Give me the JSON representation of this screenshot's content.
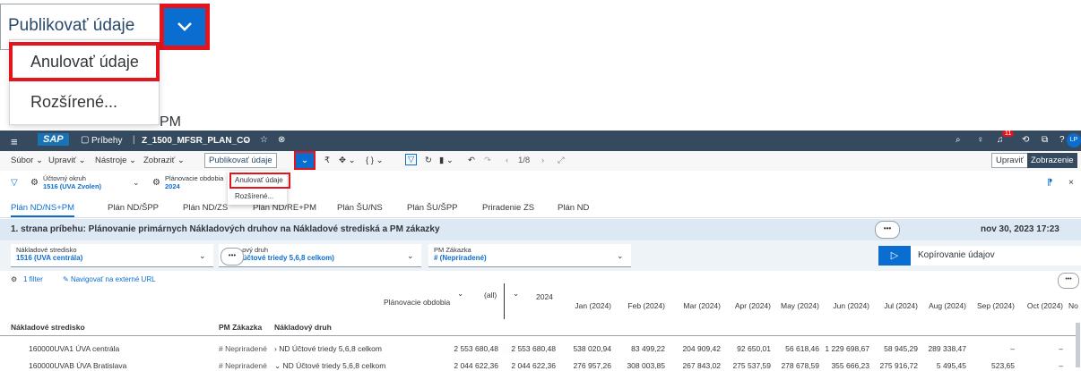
{
  "zoom": {
    "publish_label": "Publikovať údaje",
    "menu_items": [
      "Anulovať údaje",
      "Rozšírené..."
    ],
    "cutoff_text": "PM"
  },
  "shell": {
    "logo": "SAP",
    "stories_label": "Príbehy",
    "story_title": "Z_1500_MFSR_PLAN_CO",
    "notification_count": "11",
    "avatar": "LP"
  },
  "toolbar": {
    "menus": [
      "Súbor",
      "Upraviť",
      "Nástroje",
      "Zobraziť"
    ],
    "publish_label": "Publikovať údaje",
    "page_indicator": "1/8",
    "edit_button": "Upraviť",
    "view_button": "Zobrazenie"
  },
  "filters": [
    {
      "label": "Účtovný okruh",
      "value": "1516 (UVA Zvolen)"
    },
    {
      "label": "Plánovacie obdobia",
      "value": "2024"
    }
  ],
  "dropdown": {
    "items": [
      "Anulovať údaje",
      "Rozšírené..."
    ]
  },
  "tabs": [
    "Plán ND/NS+PM",
    "Plán ND/ŠPP",
    "Plán ND/ZS",
    "Plán ND/RE+PM",
    "Plán ŠU/NS",
    "Plán ŠU/ŠPP",
    "Priradenie ZS",
    "Plán ND"
  ],
  "page": {
    "title": "1. strana príbehu: Plánovanie primárnych Nákladových druhov na Nákladové strediská a PM zákazky",
    "date": "nov 30, 2023 17:23"
  },
  "controls": [
    {
      "label": "Nákladové stredisko",
      "value": "1516 (UVA centrála)"
    },
    {
      "label": "...ový druh",
      "value": "...účtové triedy 5,6,8 celkom)"
    },
    {
      "label": "PM Zákazka",
      "value": "# (Nepriradené)"
    }
  ],
  "copy_button": "Kopírovanie údajov",
  "table": {
    "filter_count": "1 filter",
    "external_link": "Navigovať na externé URL",
    "period_label": "Plánovacie obdobia",
    "all_label": "(all)",
    "year_label": "2024",
    "months": [
      "Jan (2024)",
      "Feb (2024)",
      "Mar (2024)",
      "Apr (2024)",
      "May (2024)",
      "Jun (2024)",
      "Jul (2024)",
      "Aug (2024)",
      "Sep (2024)",
      "Oct (2024)",
      "No"
    ],
    "headers": [
      "Nákladové stredisko",
      "PM Zákazka",
      "Nákladový druh"
    ],
    "rows": [
      {
        "center": "160000UVA1 ÚVA centrála",
        "pm": "# Nepriradené",
        "type": "ND Účtové triedy 5,6,8 celkom",
        "all": "2 553 680,48",
        "year": "2 553 680,48",
        "months": [
          "538 020,94",
          "83 499,22",
          "204 909,42",
          "92 650,01",
          "56 618,46",
          "1 229 698,67",
          "58 945,29",
          "289 338,47",
          "–",
          "–"
        ]
      },
      {
        "center": "160000UVAB ÚVA Bratislava",
        "pm": "# Nepriradené",
        "type": "ND Účtové triedy 5,6,8 celkom",
        "all": "2 044 622,36",
        "year": "2 044 622,36",
        "months": [
          "276 957,26",
          "308 003,85",
          "267 843,02",
          "275 537,59",
          "278 678,59",
          "355 666,23",
          "275 916,72",
          "5 495,45",
          "523,65",
          "–"
        ]
      }
    ]
  }
}
